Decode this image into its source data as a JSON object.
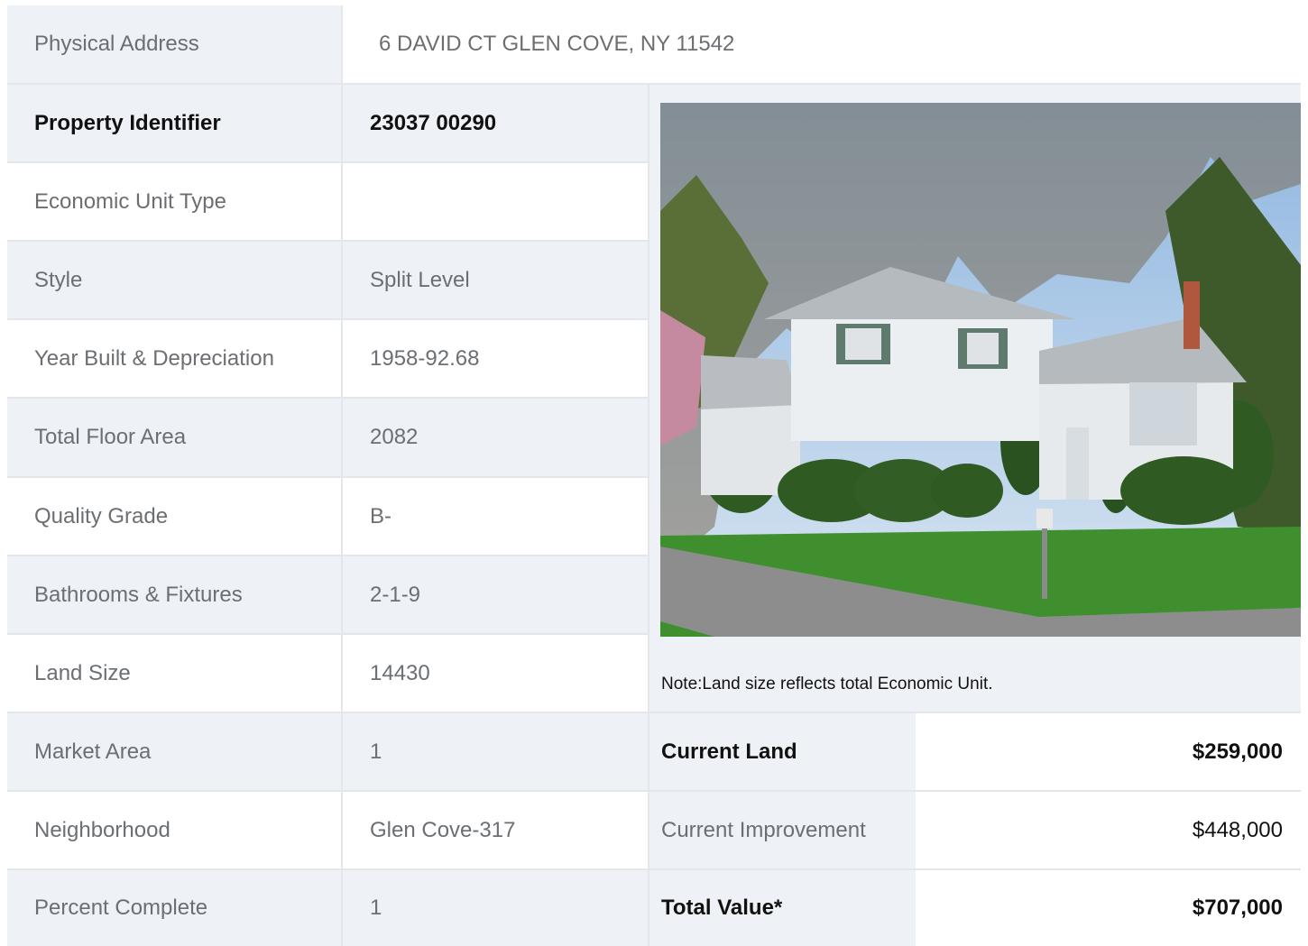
{
  "address": {
    "label": "Physical Address",
    "value": "6  DAVID CT  GLEN COVE, NY  11542"
  },
  "rows": [
    {
      "label": "Property Identifier",
      "value": "23037  00290"
    },
    {
      "label": "Economic Unit Type",
      "value": ""
    },
    {
      "label": "Style",
      "value": "Split Level"
    },
    {
      "label": "Year Built & Depreciation",
      "value": "1958-92.68"
    },
    {
      "label": "Total Floor Area",
      "value": "2082"
    },
    {
      "label": "Quality Grade",
      "value": "B-"
    },
    {
      "label": "Bathrooms & Fixtures",
      "value": "2-1-9"
    },
    {
      "label": "Land Size",
      "value": "14430"
    },
    {
      "label": "Market Area",
      "value": "1"
    },
    {
      "label": "Neighborhood",
      "value": "Glen Cove-317"
    },
    {
      "label": "Percent Complete",
      "value": "1"
    }
  ],
  "note": "Note:Land size reflects total Economic Unit.",
  "values": [
    {
      "label": "Current Land",
      "value": "$259,000"
    },
    {
      "label": "Current Improvement",
      "value": "$448,000"
    },
    {
      "label": "Total Value*",
      "value": "$707,000"
    }
  ],
  "photo": {
    "icon": "house-photo",
    "colors": {
      "sky": "#a9c8e8",
      "grass": "#3f8f2e",
      "siding": "#e9ecef",
      "roof": "#b9bdc2",
      "shutter": "#4f7a6a"
    }
  }
}
